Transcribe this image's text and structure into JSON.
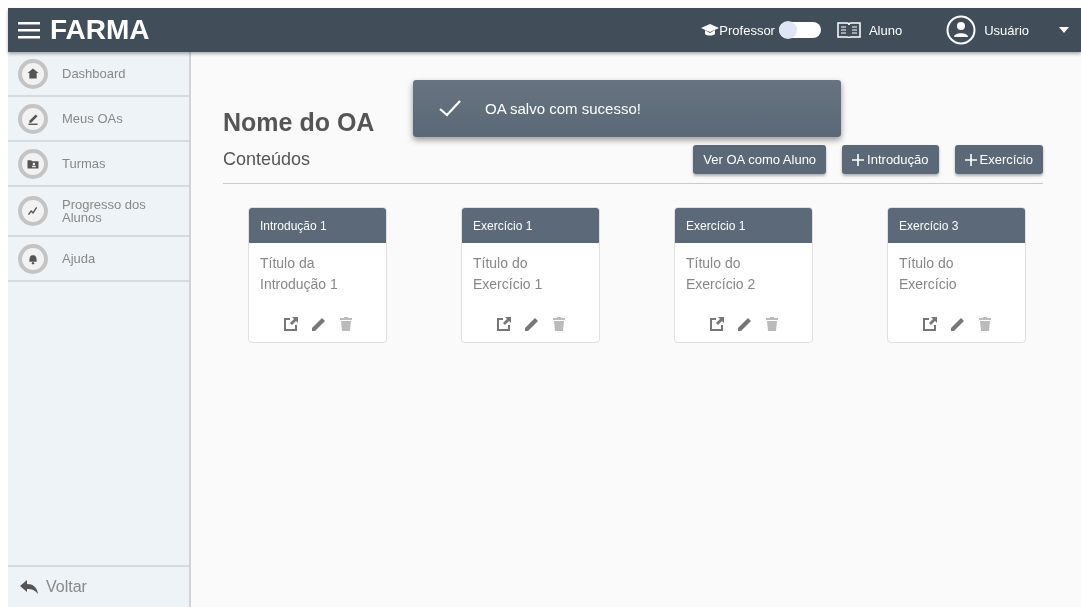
{
  "header": {
    "logo": "FARMA",
    "mode_left": "Professor",
    "mode_toggle": {
      "on": false
    },
    "mode_right": "Aluno",
    "user": "Usuário"
  },
  "sidebar": {
    "items": [
      {
        "label": "Dashboard"
      },
      {
        "label": "Meus OAs"
      },
      {
        "label": "Turmas"
      },
      {
        "label": "Progresso dos Alunos"
      },
      {
        "label": "Ajuda"
      }
    ],
    "back": "Voltar"
  },
  "toast": {
    "message": "OA salvo com sucesso!"
  },
  "title": "Nome do OA",
  "section": "Conteúdos",
  "actions": [
    {
      "label": "Ver OA como Aluno",
      "kind": "plain"
    },
    {
      "label": "Introdução",
      "kind": "add"
    },
    {
      "label": "Exercício",
      "kind": "add"
    }
  ],
  "cards": [
    {
      "header": "Introdução 1",
      "title": "Título da Introdução 1"
    },
    {
      "header": "Exercício 1",
      "title": "Título do Exercício 1"
    },
    {
      "header": "Exercício 1",
      "title": "Título do Exercício 2"
    },
    {
      "header": "Exercício 3",
      "title": "Título do Exercício"
    }
  ]
}
